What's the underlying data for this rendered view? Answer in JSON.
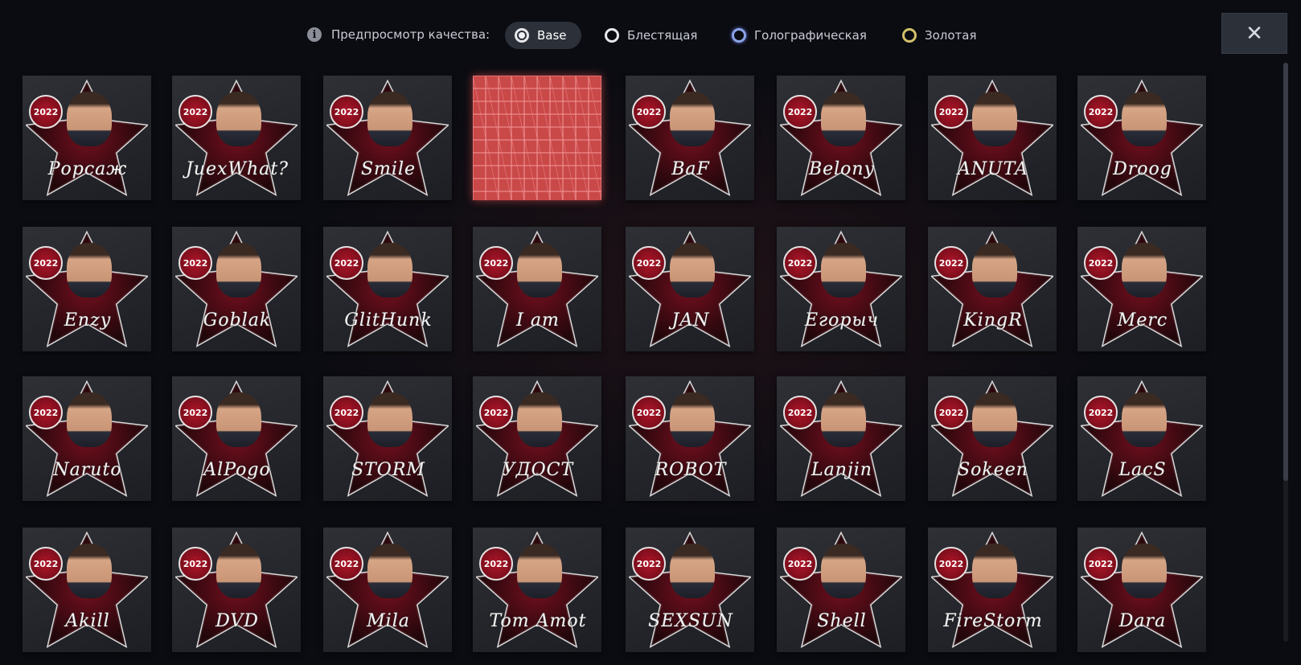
{
  "header": {
    "preview_label": "Предпросмотр качества:",
    "quality_options": [
      {
        "label": "Base",
        "selected": true
      },
      {
        "label": "Блестящая",
        "selected": false
      },
      {
        "label": "Голографическая",
        "selected": false
      },
      {
        "label": "Золотая",
        "selected": false
      }
    ],
    "close_symbol": "✕"
  },
  "colors": {
    "background": "#0b0c12",
    "badge_red": "#b0162a",
    "card_gray": "#2e3036",
    "placeholder_red": "#c94848",
    "holo_ring": "#8aa4e8",
    "gold_ring": "#d4c16a"
  },
  "stickers": [
    {
      "year": "2022",
      "signature": "Рорсаж"
    },
    {
      "year": "2022",
      "signature": "JuexWhat?"
    },
    {
      "year": "2022",
      "signature": "Smile"
    },
    {
      "placeholder": true
    },
    {
      "year": "2022",
      "signature": "BaF"
    },
    {
      "year": "2022",
      "signature": "Belony"
    },
    {
      "year": "2022",
      "signature": "ANUTA"
    },
    {
      "year": "2022",
      "signature": "Droog"
    },
    {
      "year": "2022",
      "signature": "Enzy"
    },
    {
      "year": "2022",
      "signature": "Goblak"
    },
    {
      "year": "2022",
      "signature": "GlitHunk"
    },
    {
      "year": "2022",
      "signature": "I am"
    },
    {
      "year": "2022",
      "signature": "JAN"
    },
    {
      "year": "2022",
      "signature": "Егорыч"
    },
    {
      "year": "2022",
      "signature": "KingR"
    },
    {
      "year": "2022",
      "signature": "Merc"
    },
    {
      "year": "2022",
      "signature": "Naruto"
    },
    {
      "year": "2022",
      "signature": "AlPogo"
    },
    {
      "year": "2022",
      "signature": "STORM"
    },
    {
      "year": "2022",
      "signature": "УДОСТ"
    },
    {
      "year": "2022",
      "signature": "ROBOT"
    },
    {
      "year": "2022",
      "signature": "Lanjin"
    },
    {
      "year": "2022",
      "signature": "Sokeen"
    },
    {
      "year": "2022",
      "signature": "LacS"
    },
    {
      "year": "2022",
      "signature": "Akill"
    },
    {
      "year": "2022",
      "signature": "DVD"
    },
    {
      "year": "2022",
      "signature": "Mila"
    },
    {
      "year": "2022",
      "signature": "Tom Amot"
    },
    {
      "year": "2022",
      "signature": "SEXSUN"
    },
    {
      "year": "2022",
      "signature": "Shell"
    },
    {
      "year": "2022",
      "signature": "FireStorm"
    },
    {
      "year": "2022",
      "signature": "Dara"
    }
  ]
}
